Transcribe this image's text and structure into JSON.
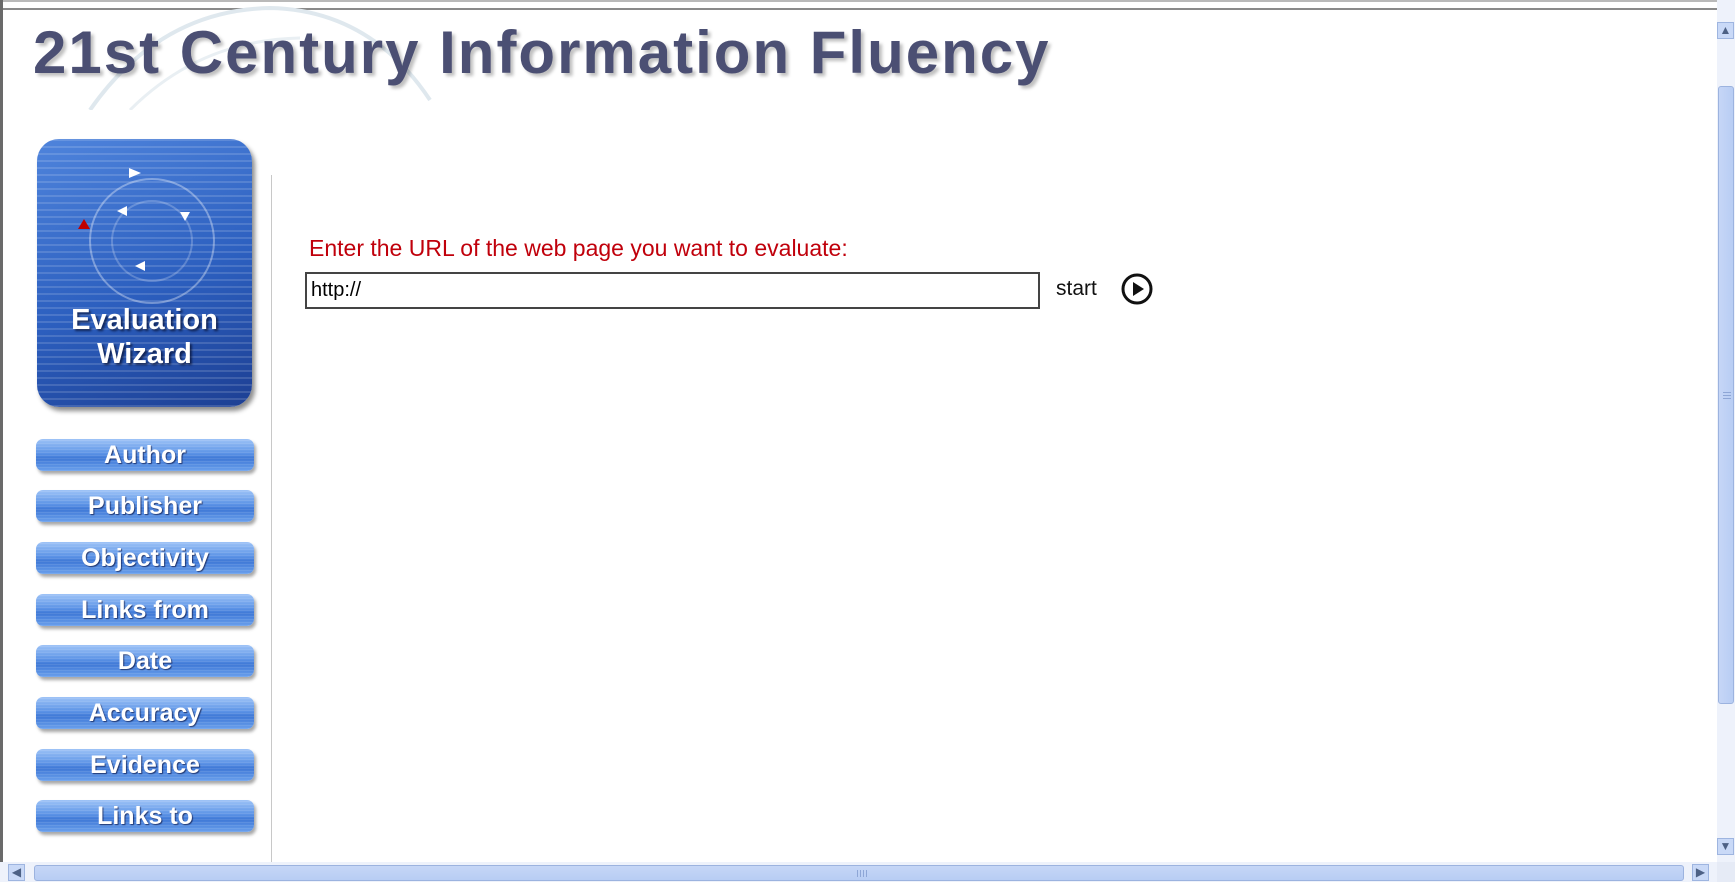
{
  "header": {
    "title": "21st Century Information Fluency"
  },
  "wizard": {
    "line1": "Evaluation",
    "line2": "Wizard"
  },
  "nav": [
    {
      "label": "Author"
    },
    {
      "label": "Publisher"
    },
    {
      "label": "Objectivity"
    },
    {
      "label": "Links from"
    },
    {
      "label": "Date"
    },
    {
      "label": "Accuracy"
    },
    {
      "label": "Evidence"
    },
    {
      "label": "Links to"
    }
  ],
  "form": {
    "prompt": "Enter the URL of the web page you want to evaluate:",
    "url_value": "http://",
    "start_label": "start"
  },
  "colors": {
    "title": "#4b4f73",
    "prompt": "#c0000b",
    "nav_button": "#5c93e6",
    "wizard_bg": "#2c5fbf"
  },
  "icons": {
    "start": "play-circle-icon",
    "scroll_up": "chevron-up-icon",
    "scroll_down": "chevron-down-icon",
    "scroll_left": "chevron-left-icon",
    "scroll_right": "chevron-right-icon"
  }
}
